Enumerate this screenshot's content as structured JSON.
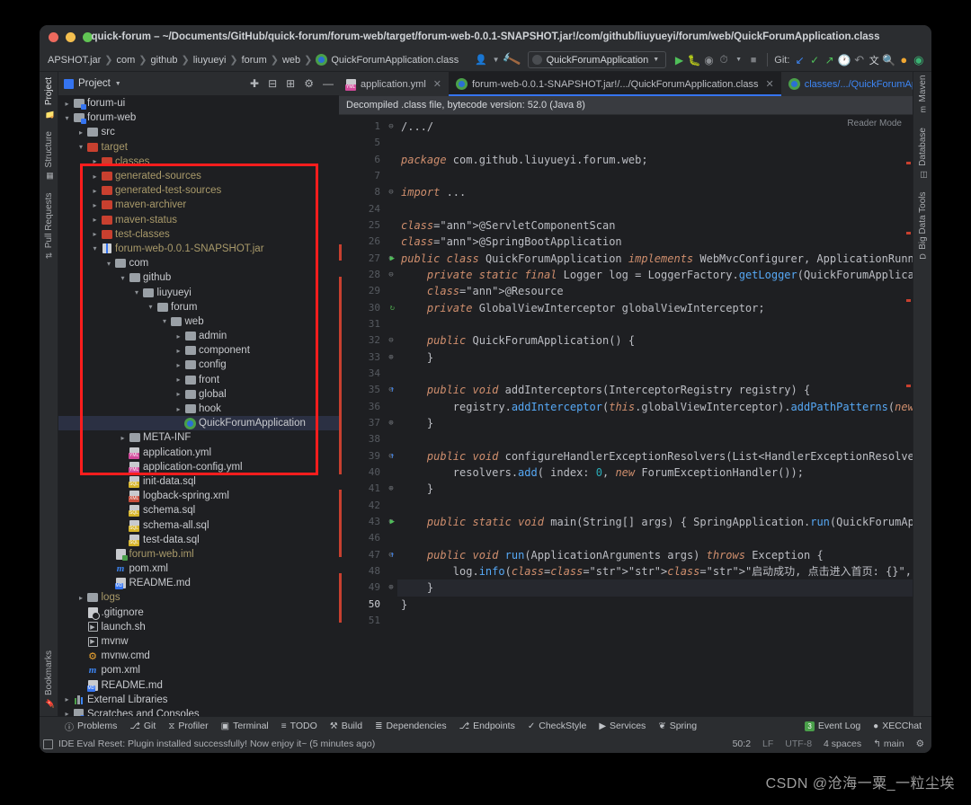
{
  "window": {
    "title": "quick-forum – ~/Documents/GitHub/quick-forum/forum-web/target/forum-web-0.0.1-SNAPSHOT.jar!/com/github/liuyueyi/forum/web/QuickForumApplication.class"
  },
  "toolbar": {
    "breadcrumbs": [
      "APSHOT.jar",
      "com",
      "github",
      "liuyueyi",
      "forum",
      "web",
      "QuickForumApplication.class"
    ],
    "run_config": "QuickForumApplication",
    "git_label": "Git:",
    "icons": {
      "profile": "user-profile-icon",
      "build": "hammer-icon",
      "run": "run-icon",
      "debug": "debug-icon",
      "coverage": "run-with-coverage-icon",
      "profiler": "profile-icon",
      "stop": "stop-icon",
      "update": "git-update-icon",
      "commit": "git-commit-icon",
      "push": "git-push-icon",
      "history": "history-icon",
      "rollback": "rollback-icon",
      "translate": "translate-icon",
      "search": "search-everywhere-icon",
      "updates": "updates-icon",
      "ide": "ide-icon"
    }
  },
  "left_rail": {
    "top": [
      "Project",
      "Structure",
      "Pull Requests"
    ],
    "bottom": [
      "Bookmarks"
    ]
  },
  "right_rail": [
    "Maven",
    "Database",
    "Big Data Tools"
  ],
  "project_panel": {
    "title": "Project",
    "tree": [
      {
        "indent": 1,
        "arrow": "right",
        "icon": "module-folder",
        "label": "forum-ui",
        "cls": "white"
      },
      {
        "indent": 1,
        "arrow": "down",
        "icon": "module-folder",
        "label": "forum-web",
        "cls": "white"
      },
      {
        "indent": 2,
        "arrow": "right",
        "icon": "folder-grey",
        "label": "src",
        "cls": "white"
      },
      {
        "indent": 2,
        "arrow": "down",
        "icon": "folder-red",
        "label": "target",
        "cls": "tan"
      },
      {
        "indent": 3,
        "arrow": "right",
        "icon": "folder-red",
        "label": "classes",
        "cls": "tan"
      },
      {
        "indent": 3,
        "arrow": "right",
        "icon": "folder-red",
        "label": "generated-sources",
        "cls": "tan"
      },
      {
        "indent": 3,
        "arrow": "right",
        "icon": "folder-red",
        "label": "generated-test-sources",
        "cls": "tan"
      },
      {
        "indent": 3,
        "arrow": "right",
        "icon": "folder-red",
        "label": "maven-archiver",
        "cls": "tan"
      },
      {
        "indent": 3,
        "arrow": "right",
        "icon": "folder-red",
        "label": "maven-status",
        "cls": "tan"
      },
      {
        "indent": 3,
        "arrow": "right",
        "icon": "folder-red",
        "label": "test-classes",
        "cls": "tan"
      },
      {
        "indent": 3,
        "arrow": "down",
        "icon": "jar",
        "label": "forum-web-0.0.1-SNAPSHOT.jar",
        "cls": "tan"
      },
      {
        "indent": 4,
        "arrow": "down",
        "icon": "folder-grey",
        "label": "com",
        "cls": "white"
      },
      {
        "indent": 5,
        "arrow": "down",
        "icon": "folder-grey",
        "label": "github",
        "cls": "white"
      },
      {
        "indent": 6,
        "arrow": "down",
        "icon": "folder-grey",
        "label": "liuyueyi",
        "cls": "white"
      },
      {
        "indent": 7,
        "arrow": "down",
        "icon": "folder-grey",
        "label": "forum",
        "cls": "white"
      },
      {
        "indent": 8,
        "arrow": "down",
        "icon": "folder-grey",
        "label": "web",
        "cls": "white"
      },
      {
        "indent": 9,
        "arrow": "right",
        "icon": "folder-grey",
        "label": "admin",
        "cls": "white"
      },
      {
        "indent": 9,
        "arrow": "right",
        "icon": "folder-grey",
        "label": "component",
        "cls": "white"
      },
      {
        "indent": 9,
        "arrow": "right",
        "icon": "folder-grey",
        "label": "config",
        "cls": "white"
      },
      {
        "indent": 9,
        "arrow": "right",
        "icon": "folder-grey",
        "label": "front",
        "cls": "white"
      },
      {
        "indent": 9,
        "arrow": "right",
        "icon": "folder-grey",
        "label": "global",
        "cls": "white"
      },
      {
        "indent": 9,
        "arrow": "right",
        "icon": "folder-grey",
        "label": "hook",
        "cls": "white"
      },
      {
        "indent": 9,
        "arrow": "none",
        "icon": "spring-class",
        "label": "QuickForumApplication",
        "cls": "white",
        "selected": true
      },
      {
        "indent": 5,
        "arrow": "right",
        "icon": "folder-grey",
        "label": "META-INF",
        "cls": "white"
      },
      {
        "indent": 5,
        "arrow": "none",
        "icon": "file-yml",
        "label": "application.yml",
        "cls": "white"
      },
      {
        "indent": 5,
        "arrow": "none",
        "icon": "file-yml",
        "label": "application-config.yml",
        "cls": "white"
      },
      {
        "indent": 5,
        "arrow": "none",
        "icon": "file-sql",
        "label": "init-data.sql",
        "cls": "white"
      },
      {
        "indent": 5,
        "arrow": "none",
        "icon": "file-xml",
        "label": "logback-spring.xml",
        "cls": "white"
      },
      {
        "indent": 5,
        "arrow": "none",
        "icon": "file-sql",
        "label": "schema.sql",
        "cls": "white"
      },
      {
        "indent": 5,
        "arrow": "none",
        "icon": "file-sql",
        "label": "schema-all.sql",
        "cls": "white"
      },
      {
        "indent": 5,
        "arrow": "none",
        "icon": "file-sql",
        "label": "test-data.sql",
        "cls": "white"
      },
      {
        "indent": 4,
        "arrow": "none",
        "icon": "iml",
        "label": "forum-web.iml",
        "cls": "tan"
      },
      {
        "indent": 4,
        "arrow": "none",
        "icon": "maven",
        "label": "pom.xml",
        "cls": "white"
      },
      {
        "indent": 4,
        "arrow": "none",
        "icon": "file-md",
        "label": "README.md",
        "cls": "white"
      },
      {
        "indent": 2,
        "arrow": "right",
        "icon": "folder-grey",
        "label": "logs",
        "cls": "tan"
      },
      {
        "indent": 2,
        "arrow": "none",
        "icon": "gitignore",
        "label": ".gitignore",
        "cls": "white"
      },
      {
        "indent": 2,
        "arrow": "none",
        "icon": "shell",
        "label": "launch.sh",
        "cls": "white"
      },
      {
        "indent": 2,
        "arrow": "none",
        "icon": "shell",
        "label": "mvnw",
        "cls": "white"
      },
      {
        "indent": 2,
        "arrow": "none",
        "icon": "cmd",
        "label": "mvnw.cmd",
        "cls": "white"
      },
      {
        "indent": 2,
        "arrow": "none",
        "icon": "maven",
        "label": "pom.xml",
        "cls": "white"
      },
      {
        "indent": 2,
        "arrow": "none",
        "icon": "file-md",
        "label": "README.md",
        "cls": "white"
      },
      {
        "indent": 1,
        "arrow": "right",
        "icon": "ext-lib",
        "label": "External Libraries",
        "cls": "white"
      },
      {
        "indent": 1,
        "arrow": "right",
        "icon": "scratches",
        "label": "Scratches and Consoles",
        "cls": "white"
      }
    ]
  },
  "editor": {
    "tabs": [
      {
        "label": "application.yml",
        "icon": "yml-icon",
        "active": false,
        "highlight": false
      },
      {
        "label": "forum-web-0.0.1-SNAPSHOT.jar!/.../QuickForumApplication.class",
        "icon": "spring-class-icon",
        "active": true,
        "highlight": false
      },
      {
        "label": "classes/.../QuickForumApplication.class",
        "icon": "spring-class-icon",
        "active": false,
        "highlight": true
      }
    ],
    "notice": "Decompiled .class file, bytecode version: 52.0 (Java 8)",
    "reader_mode": "Reader Mode",
    "line_numbers": [
      "1",
      "5",
      "6",
      "7",
      "8",
      "24",
      "25",
      "26",
      "27",
      "28",
      "29",
      "30",
      "31",
      "32",
      "33",
      "34",
      "35",
      "36",
      "37",
      "38",
      "39",
      "40",
      "41",
      "42",
      "43",
      "46",
      "47",
      "48",
      "49",
      "50",
      "51"
    ],
    "current_line": "50",
    "lines": [
      "/.../",
      "",
      "package com.github.liuyueyi.forum.web;",
      "",
      "import ...",
      "",
      "@ServletComponentScan",
      "@SpringBootApplication",
      "public class QuickForumApplication implements WebMvcConfigurer, ApplicationRunner {",
      "    private static final Logger log = LoggerFactory.getLogger(QuickForumApplication.",
      "    @Resource",
      "    private GlobalViewInterceptor globalViewInterceptor;",
      "",
      "    public QuickForumApplication() {",
      "    }",
      "",
      "    public void addInterceptors(InterceptorRegistry registry) {",
      "        registry.addInterceptor(this.globalViewInterceptor).addPathPatterns(new Stri",
      "    }",
      "",
      "    public void configureHandlerExceptionResolvers(List<HandlerExceptionResolver> re",
      "        resolvers.add( index: 0, new ForumExceptionHandler());",
      "    }",
      "",
      "    public static void main(String[] args) { SpringApplication.run(QuickForumApplica",
      "",
      "    public void run(ApplicationArguments args) throws Exception {",
      "        log.info(\"启动成功, 点击进入首页: {}\", ((GlobalViewConfig)SpringUtil.getBean(Glob",
      "    }",
      "}",
      ""
    ]
  },
  "bottom_toolwindows": [
    {
      "label": "Problems",
      "icon": "problems-icon"
    },
    {
      "label": "Git",
      "icon": "git-icon"
    },
    {
      "label": "Profiler",
      "icon": "profiler-icon"
    },
    {
      "label": "Terminal",
      "icon": "terminal-icon"
    },
    {
      "label": "TODO",
      "icon": "todo-icon"
    },
    {
      "label": "Build",
      "icon": "build-icon"
    },
    {
      "label": "Dependencies",
      "icon": "dependencies-icon"
    },
    {
      "label": "Endpoints",
      "icon": "endpoints-icon"
    },
    {
      "label": "CheckStyle",
      "icon": "checkstyle-icon"
    },
    {
      "label": "Services",
      "icon": "services-icon"
    },
    {
      "label": "Spring",
      "icon": "spring-icon"
    }
  ],
  "bottom_right_toolwindows": [
    {
      "label": "Event Log",
      "icon": "event-log-icon",
      "badge": "3"
    },
    {
      "label": "XECChat",
      "icon": "chat-icon",
      "badge": ""
    }
  ],
  "status_bar": {
    "message": "IDE Eval Reset: Plugin installed successfully! Now enjoy it~ (5 minutes ago)",
    "caret": "50:2",
    "line_separator": "LF",
    "encoding": "UTF-8",
    "indent": "4 spaces",
    "branch": "main"
  },
  "watermark": "CSDN @沧海一粟_一粒尘埃",
  "colors": {
    "accent": "#3574f0",
    "annotation_box": "#ff1d1d",
    "editor_bg": "#1e1f22",
    "panel_bg": "#2b2d30",
    "error_stripe": "#c8402f"
  }
}
